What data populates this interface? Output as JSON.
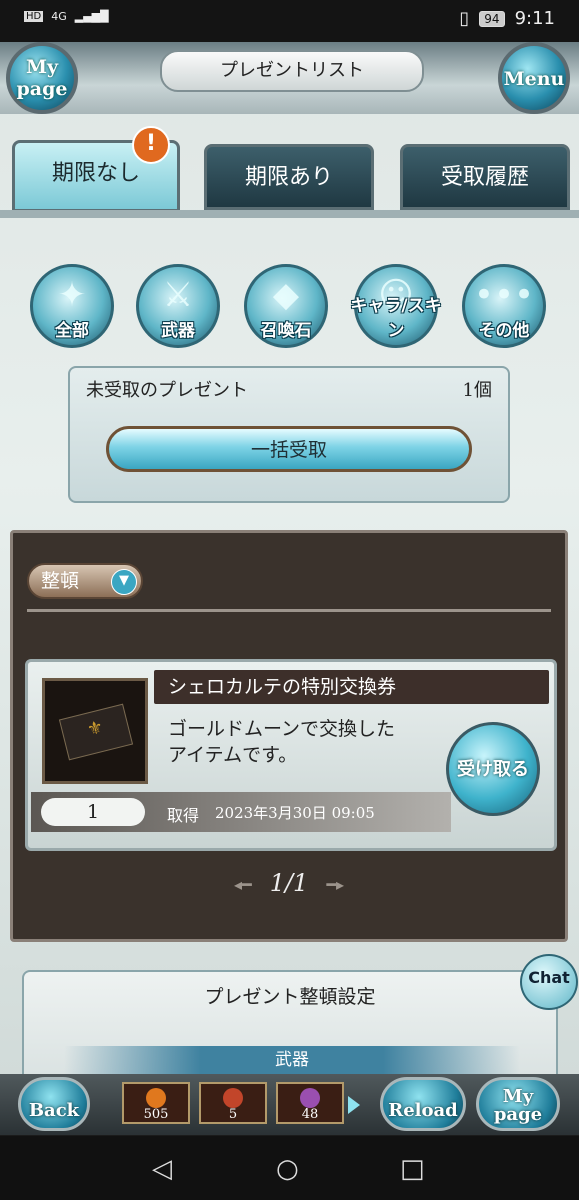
{
  "status_bar": {
    "network": "4G",
    "battery": "94",
    "time": "9:11"
  },
  "header": {
    "title": "プレゼントリスト",
    "mypage_label_1": "My",
    "mypage_label_2": "page",
    "menu_label": "Menu"
  },
  "tabs": [
    {
      "label": "期限なし",
      "active": true
    },
    {
      "label": "期限あり",
      "active": false
    },
    {
      "label": "受取履歴",
      "active": false
    }
  ],
  "badge": "!",
  "filters": [
    {
      "label": "全部",
      "icon": "all-items-icon"
    },
    {
      "label": "武器",
      "icon": "sword-icon"
    },
    {
      "label": "召喚石",
      "icon": "crystal-icon"
    },
    {
      "label": "キャラ/スキン",
      "icon": "character-icon"
    },
    {
      "label": "その他",
      "icon": "more-icon"
    }
  ],
  "unclaimed": {
    "label": "未受取のプレゼント",
    "count": "1個",
    "claim_all_label": "一括受取"
  },
  "list": {
    "sort_label": "整頓",
    "items": [
      {
        "name": "シェロカルテの特別交換券",
        "desc_line1": "ゴールドムーンで交換した",
        "desc_line2": "アイテムです。",
        "receive_label": "受け取る",
        "quantity": "1",
        "acquired_label": "取得",
        "acquired_date": "2023年3月30日 09:05"
      }
    ],
    "pager": "1/1"
  },
  "settings": {
    "title": "プレゼント整頓設定",
    "category": "武器"
  },
  "chat_label": "Chat",
  "bottom_bar": {
    "back_label": "Back",
    "reload_label": "Reload",
    "mypage_1": "My",
    "mypage_2": "page",
    "items": [
      {
        "count": "505",
        "color": "#e0781e"
      },
      {
        "count": "5",
        "color": "#c2452a"
      },
      {
        "count": "48",
        "color": "#9a4fb0"
      }
    ]
  },
  "colors": {
    "accent": "#3aa6c2",
    "dark_panel": "#3a322c",
    "tab_active": "#7cc9d6"
  }
}
